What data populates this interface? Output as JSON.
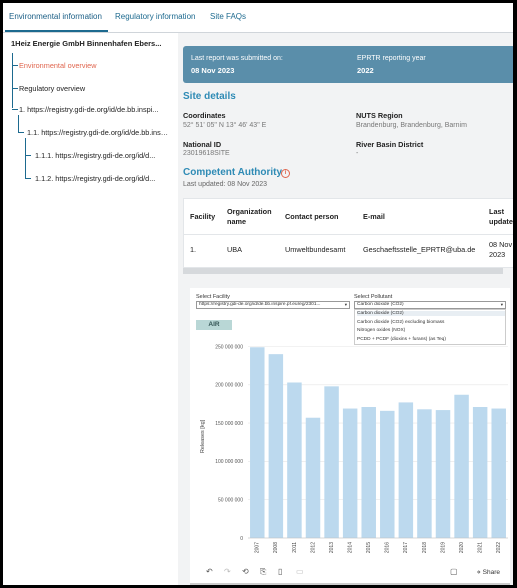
{
  "tabs": [
    {
      "label": "Environmental information"
    },
    {
      "label": "Regulatory information"
    },
    {
      "label": "Site FAQs"
    }
  ],
  "sidebar": {
    "root": "1Heiz Energie GmbH Binnenhafen Ebers...",
    "items": [
      {
        "label": "Environmental overview",
        "active": true
      },
      {
        "label": "Regulatory overview"
      },
      {
        "label": "1. https://registry.gdi-de.org/id/de.bb.inspi..."
      },
      {
        "label": "1.1. https://registry.gdi-de.org/id/de.bb.inspi..."
      },
      {
        "label": "1.1.1. https://registry.gdi-de.org/id/d..."
      },
      {
        "label": "1.1.2. https://registry.gdi-de.org/id/d..."
      }
    ]
  },
  "banner": {
    "last_report_label": "Last report was submitted on:",
    "last_report_value": "08 Nov 2023",
    "year_label": "EPRTR reporting year",
    "year_value": "2022"
  },
  "site_details": {
    "title": "Site details",
    "coordinates_label": "Coordinates",
    "coordinates_value": "52° 51' 05\" N 13° 46' 43\" E",
    "nuts_label": "NUTS Region",
    "nuts_value": "Brandenburg, Brandenburg, Barnim",
    "national_id_label": "National ID",
    "national_id_value": "23019618SITE",
    "river_label": "River Basin District",
    "river_value": "-"
  },
  "competent_authority": {
    "title": "Competent Authority",
    "info_icon": "info-icon",
    "updated": "Last updated: 08 Nov 2023",
    "headers": [
      "Facility",
      "Organization name",
      "Contact person",
      "E-mail",
      "Last updated"
    ],
    "row": [
      "1.",
      "UBA",
      "Umweltbundesamt",
      "Geschaeftsstelle_EPRTR@uba.de",
      "08 Nov 2023"
    ]
  },
  "dashboard": {
    "facility_label": "Select Facility",
    "facility_value": "https://registry.gdi-de.org/id/de.bb.inspire.pf.eureg/2301...",
    "pollutant_label": "Select Pollutant",
    "pollutant_value": "Carbon dioxide (CO2)",
    "pollutant_options": [
      "Carbon dioxide (CO2)",
      "Carbon dioxide (CO2) excluding biomass",
      "Nitrogen oxides (NOX)",
      "PCDD + PCDF (dioxins + furans) (as Teq)"
    ],
    "medium_badge": "AIR",
    "share_label": "Share"
  },
  "chart_data": {
    "type": "bar",
    "categories": [
      "2007",
      "2008",
      "2011",
      "2012",
      "2013",
      "2014",
      "2015",
      "2016",
      "2017",
      "2018",
      "2019",
      "2020",
      "2021",
      "2022"
    ],
    "values": [
      249000000,
      240000000,
      203000000,
      157000000,
      198000000,
      169000000,
      171000000,
      166000000,
      177000000,
      168000000,
      167000000,
      187000000,
      171000000,
      169000000
    ],
    "ylabel": "Releases [kg]",
    "ylim": [
      0,
      265000000
    ],
    "yticks": [
      0,
      50000000,
      100000000,
      150000000,
      200000000,
      250000000
    ],
    "ytick_labels": [
      "0",
      "50 000 000",
      "100 000 000",
      "150 000 000",
      "200 000 000",
      "250 000 000"
    ],
    "color": "#bcd9ee",
    "grid": true
  }
}
